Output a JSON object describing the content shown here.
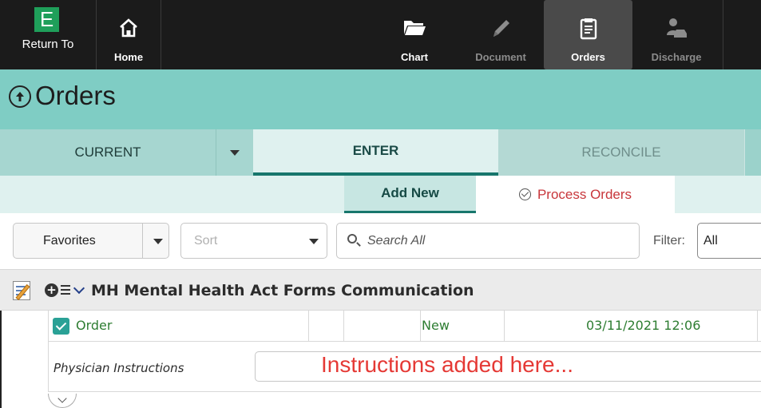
{
  "toolbar": {
    "return_to": {
      "badge": "E",
      "label": "Return To"
    },
    "home": {
      "label": "Home",
      "icon": "home-icon"
    },
    "chart": {
      "label": "Chart",
      "icon": "folder-icon"
    },
    "document": {
      "label": "Document",
      "icon": "pencil-icon",
      "disabled": true
    },
    "orders": {
      "label": "Orders",
      "icon": "clipboard-icon",
      "active": true
    },
    "discharge": {
      "label": "Discharge",
      "icon": "person-car-icon",
      "disabled": true
    }
  },
  "page": {
    "title": "Orders"
  },
  "tabs": [
    {
      "label": "CURRENT"
    },
    {
      "label": "ENTER",
      "active": true
    },
    {
      "label": "RECONCILE"
    }
  ],
  "subtabs": {
    "add_new": "Add New",
    "process_orders": "Process Orders"
  },
  "filters": {
    "favorites": "Favorites",
    "sort": "Sort",
    "search_placeholder": "Search All",
    "filter_label": "Filter:",
    "filter_value": "All"
  },
  "group": {
    "title": "MH Mental Health Act Forms Communication"
  },
  "order": {
    "name": "Order",
    "status": "New",
    "datetime": "03/11/2021 12:06"
  },
  "instructions": {
    "label": "Physician Instructions",
    "text": "Instructions added here..."
  },
  "colors": {
    "toolbar_bg": "#1b1b1b",
    "teal_header": "#7fcdc4",
    "accent": "#17766c",
    "process_red": "#c8363b",
    "order_green": "#2e7d32",
    "instructions_red": "#e53935"
  }
}
